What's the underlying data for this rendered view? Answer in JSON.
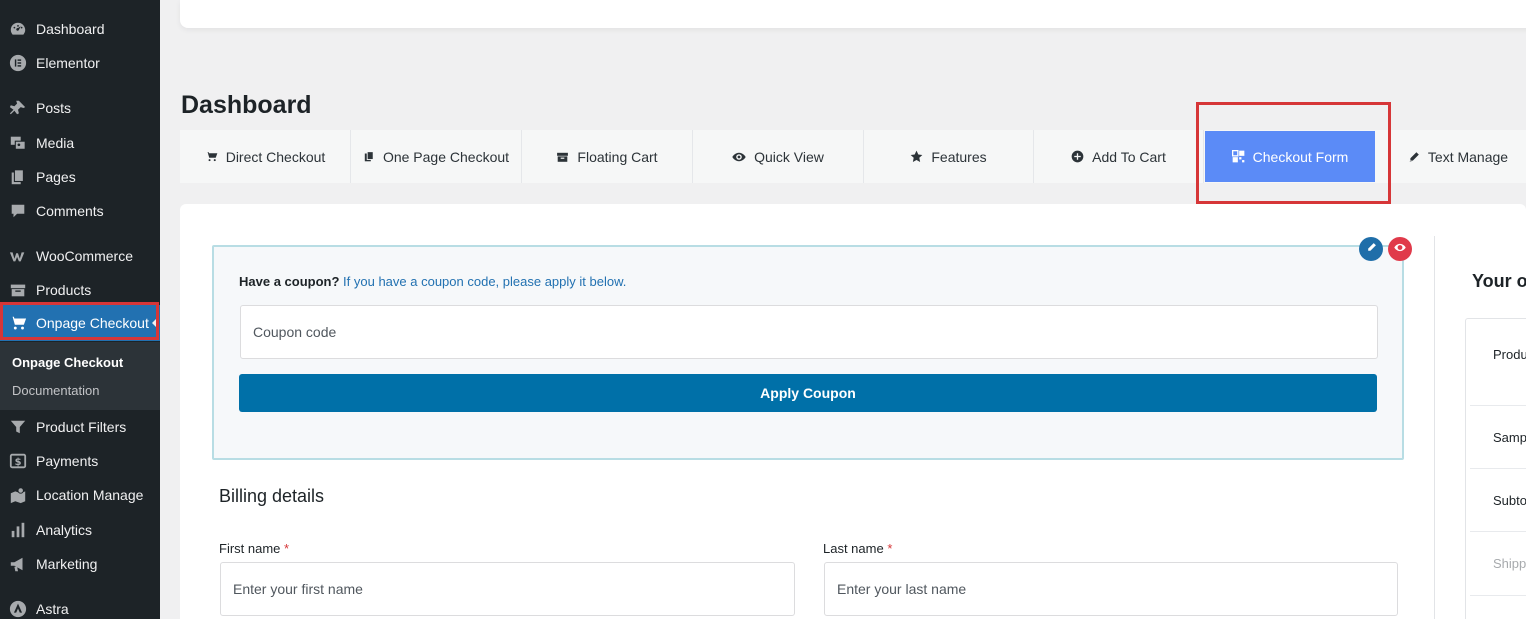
{
  "sidebar": {
    "items": [
      {
        "label": "Dashboard",
        "icon": "dashboard-icon"
      },
      {
        "label": "Elementor",
        "icon": "elementor-icon"
      },
      {
        "label": "Posts",
        "icon": "pin-icon"
      },
      {
        "label": "Media",
        "icon": "media-icon"
      },
      {
        "label": "Pages",
        "icon": "pages-icon"
      },
      {
        "label": "Comments",
        "icon": "comments-icon"
      },
      {
        "label": "WooCommerce",
        "icon": "woocommerce-icon"
      },
      {
        "label": "Products",
        "icon": "products-icon"
      },
      {
        "label": "Onpage Checkout",
        "icon": "cart-icon"
      },
      {
        "label": "Product Filters",
        "icon": "filter-icon"
      },
      {
        "label": "Payments",
        "icon": "payments-icon"
      },
      {
        "label": "Location Manage",
        "icon": "location-icon"
      },
      {
        "label": "Analytics",
        "icon": "analytics-icon"
      },
      {
        "label": "Marketing",
        "icon": "megaphone-icon"
      },
      {
        "label": "Astra",
        "icon": "astra-icon"
      }
    ],
    "submenu": [
      "Onpage Checkout",
      "Documentation"
    ]
  },
  "page": {
    "title": "Dashboard"
  },
  "tabs": [
    {
      "label": "Direct Checkout",
      "icon": "cart-icon"
    },
    {
      "label": "One Page Checkout",
      "icon": "copy-icon"
    },
    {
      "label": "Floating Cart",
      "icon": "archive-icon"
    },
    {
      "label": "Quick View",
      "icon": "eye-icon"
    },
    {
      "label": "Features",
      "icon": "star-icon"
    },
    {
      "label": "Add To Cart",
      "icon": "plus-circle-icon"
    },
    {
      "label": "Checkout Form",
      "icon": "grid-icon"
    },
    {
      "label": "Text Manage",
      "icon": "pencil-icon"
    }
  ],
  "coupon": {
    "prompt": "Have a coupon?",
    "link_text": "If you have a coupon code, please apply it below.",
    "placeholder": "Coupon code",
    "button": "Apply Coupon"
  },
  "billing": {
    "title": "Billing details",
    "first_name_label": "First name",
    "first_name_placeholder": "Enter your first name",
    "last_name_label": "Last name",
    "last_name_placeholder": "Enter your last name",
    "required_mark": "*"
  },
  "order": {
    "title": "Your o",
    "rows": [
      "Produ",
      "Samp",
      "Subto",
      "Shipp"
    ]
  },
  "colors": {
    "sidebar_bg": "#1d2327",
    "active_menu": "#2271b1",
    "active_tab": "#5b8bf7",
    "apply_button": "#0070a8",
    "highlight_border": "#d63638"
  }
}
